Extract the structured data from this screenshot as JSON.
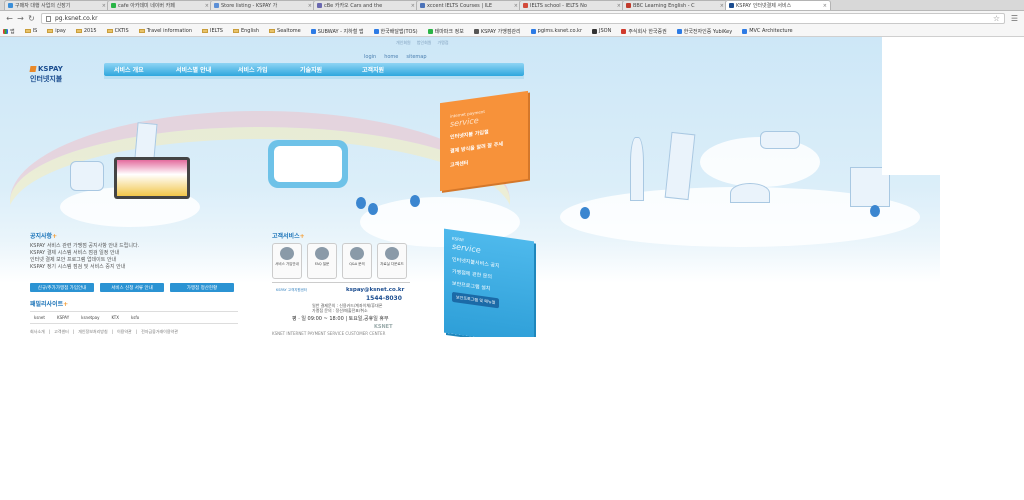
{
  "browser": {
    "tabs": [
      {
        "label": "구매자 대행 사업의 신장기",
        "color": "#3b8ed8"
      },
      {
        "label": "cafe 아카데미 네이버 카페",
        "color": "#29b446"
      },
      {
        "label": "Store listing - KSPAY 가",
        "color": "#5b8fd6"
      },
      {
        "label": "cBe 카카오 Cars and the",
        "color": "#6a68b0"
      },
      {
        "label": "xccent IELTS Courses | ILE",
        "color": "#4b72b8"
      },
      {
        "label": "IELTS school - IELTS No",
        "color": "#d24a3a"
      },
      {
        "label": "BBC Learning English - C",
        "color": "#c0392b"
      },
      {
        "label": "KSPAY 인터넷결제 서비스",
        "color": "#1a4c8f",
        "active": true
      }
    ],
    "url": "pg.ksnet.co.kr",
    "bookmarks": [
      {
        "label": "앱",
        "type": "apps"
      },
      {
        "label": "IS",
        "type": "folder"
      },
      {
        "label": "ipay",
        "type": "folder"
      },
      {
        "label": "2015",
        "type": "folder"
      },
      {
        "label": "CKTIS",
        "type": "folder"
      },
      {
        "label": "Travel information",
        "type": "folder"
      },
      {
        "label": "IELTS",
        "type": "folder"
      },
      {
        "label": "English",
        "type": "folder"
      },
      {
        "label": "Sealtome",
        "type": "folder"
      },
      {
        "label": "SUBWAY - 지하철 앱",
        "type": "site",
        "color": "#2c7be5"
      },
      {
        "label": "한국배달앱(TOS)",
        "type": "site",
        "color": "#2c7be5"
      },
      {
        "label": "테마파크 정보",
        "type": "site",
        "color": "#29b446"
      },
      {
        "label": "KSPAY 가맹점관리",
        "type": "site",
        "color": "#555"
      },
      {
        "label": "pgims.ksnet.co.kr",
        "type": "site",
        "color": "#2c7be5"
      },
      {
        "label": "JSON",
        "type": "site",
        "color": "#333"
      },
      {
        "label": "주식회사 한국증권",
        "type": "site",
        "color": "#d03a2c"
      },
      {
        "label": "한국전자인증 YubiKey",
        "type": "site",
        "color": "#2c7be5"
      },
      {
        "label": "MVC Architecture",
        "type": "site",
        "color": "#2c7be5"
      }
    ]
  },
  "site": {
    "sub_links": [
      "개인회원",
      "법인회원",
      "가맹점"
    ],
    "top_links": [
      "login",
      "home",
      "sitemap"
    ],
    "logo": {
      "brand": "KSPAY",
      "subtitle": "인터넷지불"
    },
    "gnb": [
      "서비스 개요",
      "서비스별 안내",
      "서비스 가입",
      "기술지원",
      "고객지원"
    ],
    "orange_panel": {
      "eyebrow": "internet payment",
      "title": "service",
      "items": [
        "인터넷지불 가입절",
        "결제 방식을 알려 잘 주세",
        "고객센터"
      ]
    },
    "blue_panel": {
      "eyebrow": "KSPAY",
      "title": "service",
      "items": [
        "인터넷지불서비스 공지",
        "가맹점에 관한 문의",
        "보안프로그램 설치"
      ],
      "button": "보안프로그램 및 매뉴얼"
    },
    "notice": {
      "title": "공지사항",
      "lines": [
        "KSPAY 서비스 관련 가맹점 공지사항 안내 드립니다.",
        "KSPAY 결제 시스템 서비스 점검 일정 안내",
        "인터넷 결제 보안 프로그램 업데이트 안내",
        "KSPAY 정기 시스템 점검 및 서비스 중지 안내"
      ],
      "buttons": [
        "신규/추가가맹점 가입안내",
        "서비스 신청 서류 안내",
        "가맹점 정산현황"
      ]
    },
    "family": {
      "title": "패밀리사이트",
      "logos": [
        "ksnet",
        "KSPAY",
        "ksnetpay",
        "KTX",
        "ksfo"
      ]
    },
    "footer": [
      "회사소개",
      "고객센터",
      "개인정보처리방침",
      "이용약관",
      "전자금융거래이용약관"
    ],
    "customer_service": {
      "title": "고객서비스",
      "icons": [
        "서비스 가입안내",
        "FAQ 질문",
        "Q&A 문의",
        "자료실 다운로드"
      ],
      "small": "KSPAY 고객지원센터",
      "email": "kspay@ksnet.co.kr",
      "phone": "1544-8030",
      "line1": "일반 결제문의 : 신용카드/계좌이체/휴대폰",
      "line2": "가맹점 문의 : 정산/매출전표/취소",
      "hours": "평 · 일 09:00 ~ 18:00 | 토요일,공휴일 휴무",
      "company": "KSNET",
      "footer_line": "KSNET INTERNET PAYMENT SERVICE CUSTOMER CENTER"
    }
  }
}
